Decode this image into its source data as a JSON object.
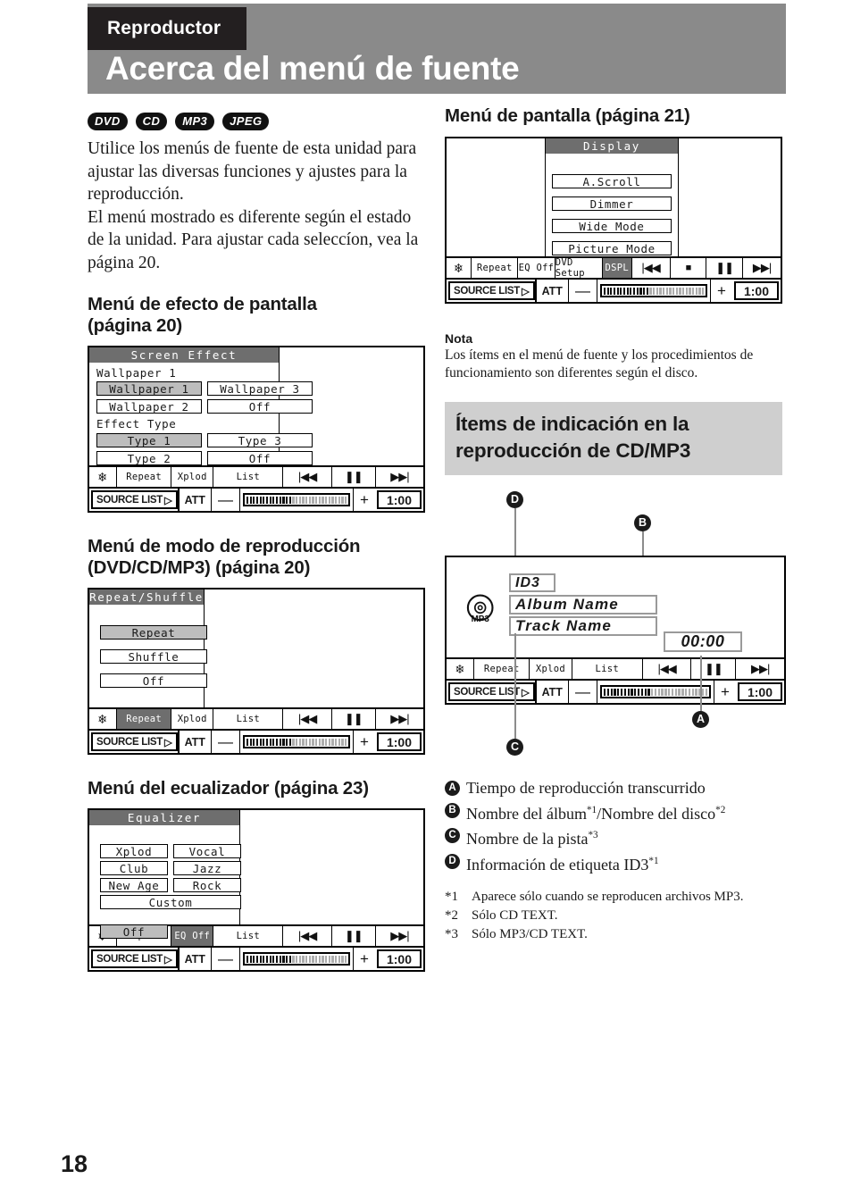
{
  "header": {
    "tab_label": "Reproductor",
    "title": "Acerca del menú de fuente"
  },
  "page_number": "18",
  "intro": {
    "badges": [
      "DVD",
      "CD",
      "MP3",
      "JPEG"
    ],
    "paragraph1": "Utilice los menús de fuente de esta unidad para ajustar las diversas funciones y ajustes para la reproducción.",
    "paragraph2": "El menú mostrado es diferente según el estado de la unidad. Para ajustar cada seleccíon, vea la página 20."
  },
  "sections": {
    "screen_effect": {
      "heading": "Menú de efecto de pantalla (página 20)",
      "panel": {
        "title": "Screen Effect",
        "group1_label": "Wallpaper 1",
        "group1_buttons": [
          {
            "label": "Wallpaper 1",
            "selected": true
          },
          {
            "label": "Wallpaper 3",
            "selected": false
          },
          {
            "label": "Wallpaper 2",
            "selected": false
          },
          {
            "label": "Off",
            "selected": false
          }
        ],
        "group2_label": "Effect Type",
        "group2_buttons": [
          {
            "label": "Type  1",
            "selected": true
          },
          {
            "label": "Type  3",
            "selected": false
          },
          {
            "label": "Type  2",
            "selected": false
          },
          {
            "label": "Off",
            "selected": false
          }
        ]
      },
      "toolbar": [
        {
          "label": "snowflake-icon",
          "type": "icon",
          "glyph": "❄",
          "selected": false
        },
        {
          "label": "Repeat",
          "type": "text",
          "selected": false
        },
        {
          "label": "Xplod",
          "type": "text",
          "selected": false
        },
        {
          "label": "List",
          "type": "text",
          "selected": false
        },
        {
          "label": "prev-icon",
          "type": "icon",
          "glyph": "◀◀",
          "selected": false
        },
        {
          "label": "pause-icon",
          "type": "icon",
          "glyph": "❚❚",
          "selected": false
        },
        {
          "label": "next-icon",
          "type": "icon",
          "glyph": "▶▶",
          "selected": false
        }
      ],
      "bottom": {
        "source": "SOURCE LIST",
        "att": "ATT",
        "minus": "—",
        "plus": "+",
        "time": "1:00",
        "volume_filled": 14,
        "volume_total": 31
      }
    },
    "play_mode": {
      "heading": "Menú de modo de reproducción (DVD/CD/MP3) (página 20)",
      "panel": {
        "title": "Repeat/Shuffle",
        "buttons": [
          {
            "label": "Repeat",
            "selected": true
          },
          {
            "label": "Shuffle",
            "selected": false
          },
          {
            "label": "Off",
            "selected": false
          }
        ]
      },
      "toolbar": [
        {
          "label": "snowflake-icon",
          "type": "icon",
          "glyph": "❄",
          "selected": false
        },
        {
          "label": "Repeat",
          "type": "text",
          "selected": true
        },
        {
          "label": "Xplod",
          "type": "text",
          "selected": false
        },
        {
          "label": "List",
          "type": "text",
          "selected": false
        },
        {
          "label": "prev-icon",
          "type": "icon",
          "glyph": "◀◀",
          "selected": false
        },
        {
          "label": "pause-icon",
          "type": "icon",
          "glyph": "❚❚",
          "selected": false
        },
        {
          "label": "next-icon",
          "type": "icon",
          "glyph": "▶▶",
          "selected": false
        }
      ],
      "bottom": {
        "source": "SOURCE LIST",
        "att": "ATT",
        "minus": "—",
        "plus": "+",
        "time": "1:00",
        "volume_filled": 14,
        "volume_total": 31
      }
    },
    "equalizer": {
      "heading": "Menú del ecualizador (página 23)",
      "panel": {
        "title": "Equalizer",
        "presets": [
          {
            "label": "Xplod",
            "selected": false
          },
          {
            "label": "Vocal",
            "selected": false
          },
          {
            "label": "Club",
            "selected": false
          },
          {
            "label": "Jazz",
            "selected": false
          },
          {
            "label": "New Age",
            "selected": false
          },
          {
            "label": "Rock",
            "selected": false
          }
        ],
        "custom": {
          "label": "Custom",
          "selected": false
        },
        "off": {
          "label": "Off",
          "selected": true
        }
      },
      "toolbar": [
        {
          "label": "snowflake-icon",
          "type": "icon",
          "glyph": "❄",
          "selected": false
        },
        {
          "label": "Repeat",
          "type": "text",
          "selected": false
        },
        {
          "label": "EQ Off",
          "type": "text",
          "selected": true
        },
        {
          "label": "List",
          "type": "text",
          "selected": false
        },
        {
          "label": "prev-icon",
          "type": "icon",
          "glyph": "◀◀",
          "selected": false
        },
        {
          "label": "pause-icon",
          "type": "icon",
          "glyph": "❚❚",
          "selected": false
        },
        {
          "label": "next-icon",
          "type": "icon",
          "glyph": "▶▶",
          "selected": false
        }
      ],
      "bottom": {
        "source": "SOURCE LIST",
        "att": "ATT",
        "minus": "—",
        "plus": "+",
        "time": "1:00",
        "volume_filled": 14,
        "volume_total": 31
      }
    },
    "display": {
      "heading": "Menú de pantalla (página 21)",
      "panel": {
        "title": "Display",
        "buttons": [
          {
            "label": "A.Scroll",
            "selected": false
          },
          {
            "label": "Dimmer",
            "selected": false
          },
          {
            "label": "Wide Mode",
            "selected": false
          },
          {
            "label": "Picture Mode",
            "selected": false
          }
        ]
      },
      "toolbar": [
        {
          "label": "snowflake-icon",
          "type": "icon",
          "glyph": "❄",
          "selected": false
        },
        {
          "label": "Repeat",
          "type": "text",
          "selected": false
        },
        {
          "label": "EQ Off",
          "type": "text",
          "selected": false
        },
        {
          "label": "DVD Setup",
          "type": "text",
          "selected": false
        },
        {
          "label": "DSPL",
          "type": "text",
          "selected": true
        },
        {
          "label": "prev-icon",
          "type": "icon",
          "glyph": "◀◀",
          "selected": false
        },
        {
          "label": "stop-icon",
          "type": "icon",
          "glyph": "■",
          "selected": false
        },
        {
          "label": "pause-icon",
          "type": "icon",
          "glyph": "❚❚",
          "selected": false
        },
        {
          "label": "next-icon",
          "type": "icon",
          "glyph": "▶▶",
          "selected": false
        }
      ],
      "bottom": {
        "source": "SOURCE LIST",
        "att": "ATT",
        "minus": "—",
        "plus": "+",
        "time": "1:00",
        "volume_filled": 14,
        "volume_total": 31
      }
    }
  },
  "note": {
    "heading": "Nota",
    "text": "Los ítems en el menú de fuente y los procedimientos de funcionamiento son diferentes según el disco."
  },
  "cd_mp3": {
    "heading": "Ítems de indicación en la reproducción de CD/MP3",
    "callouts": [
      "A",
      "B",
      "C",
      "D"
    ],
    "screen": {
      "disc_icon_label": "MP3",
      "id3": "ID3",
      "album": "Album Name",
      "track": "Track Name",
      "elapsed": "00:00"
    },
    "toolbar": [
      {
        "label": "snowflake-icon",
        "type": "icon",
        "glyph": "❄",
        "selected": false
      },
      {
        "label": "Repeat",
        "type": "text",
        "selected": false
      },
      {
        "label": "Xplod",
        "type": "text",
        "selected": false
      },
      {
        "label": "List",
        "type": "text",
        "selected": false
      },
      {
        "label": "prev-icon",
        "type": "icon",
        "glyph": "◀◀",
        "selected": false
      },
      {
        "label": "pause-icon",
        "type": "icon",
        "glyph": "❚❚",
        "selected": false
      },
      {
        "label": "next-icon",
        "type": "icon",
        "glyph": "▶▶",
        "selected": false
      }
    ],
    "bottom": {
      "source": "SOURCE LIST",
      "att": "ATT",
      "minus": "—",
      "plus": "+",
      "time": "1:00",
      "volume_filled": 14,
      "volume_total": 31
    },
    "legend": [
      {
        "mark": "A",
        "text": "Tiempo de reproducción transcurrido",
        "sup": ""
      },
      {
        "mark": "B",
        "text": "Nombre del álbum",
        "sup": "*1",
        "text2": "/Nombre del disco",
        "sup2": "*2"
      },
      {
        "mark": "C",
        "text": "Nombre de la pista",
        "sup": "*3"
      },
      {
        "mark": "D",
        "text": "Información de etiqueta ID3",
        "sup": "*1"
      }
    ],
    "footnotes": [
      {
        "key": "*1",
        "text": "Aparece sólo cuando se reproducen archivos MP3."
      },
      {
        "key": "*2",
        "text": "Sólo CD TEXT."
      },
      {
        "key": "*3",
        "text": "Sólo MP3/CD TEXT."
      }
    ]
  },
  "colors": {
    "header_bg": "#8a8a8a",
    "tab_bg": "#231f20",
    "titlebar_bg": "#6e6e6e",
    "selected_bg": "#bdbdbd",
    "section_band": "#cfcfcf"
  }
}
